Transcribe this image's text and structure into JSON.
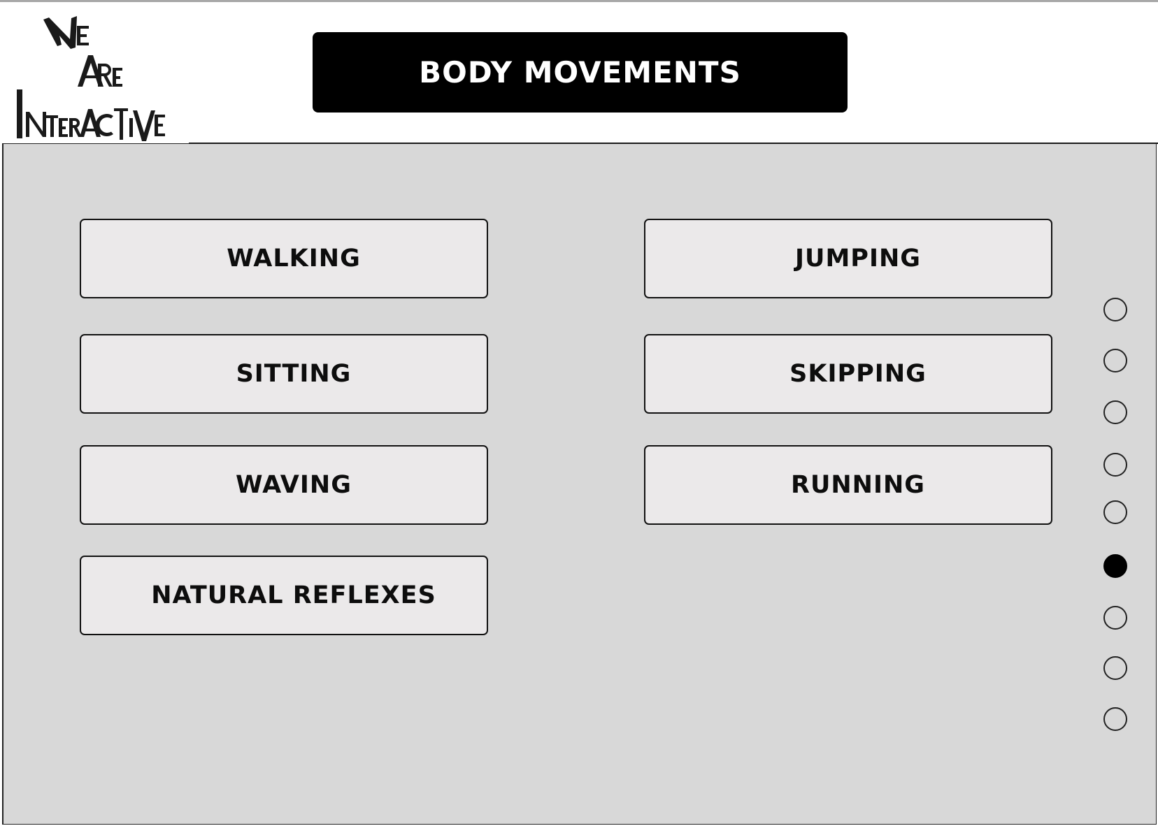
{
  "header": {
    "logo_text": "WE ARE INTERACTIVE",
    "title": "BODY MOVEMENTS"
  },
  "options": [
    {
      "label": "WALKING"
    },
    {
      "label": "JUMPING"
    },
    {
      "label": "SITTING"
    },
    {
      "label": "SKIPPING"
    },
    {
      "label": "WAVING"
    },
    {
      "label": "RUNNING"
    },
    {
      "label": "NATURAL REFLEXES"
    }
  ],
  "pagination": {
    "total_pages": 9,
    "current_page": 6
  },
  "colors": {
    "title_background": "#000000",
    "title_text": "#ffffff",
    "panel_background": "#d8d8d8",
    "button_background": "#ebe9ea"
  }
}
